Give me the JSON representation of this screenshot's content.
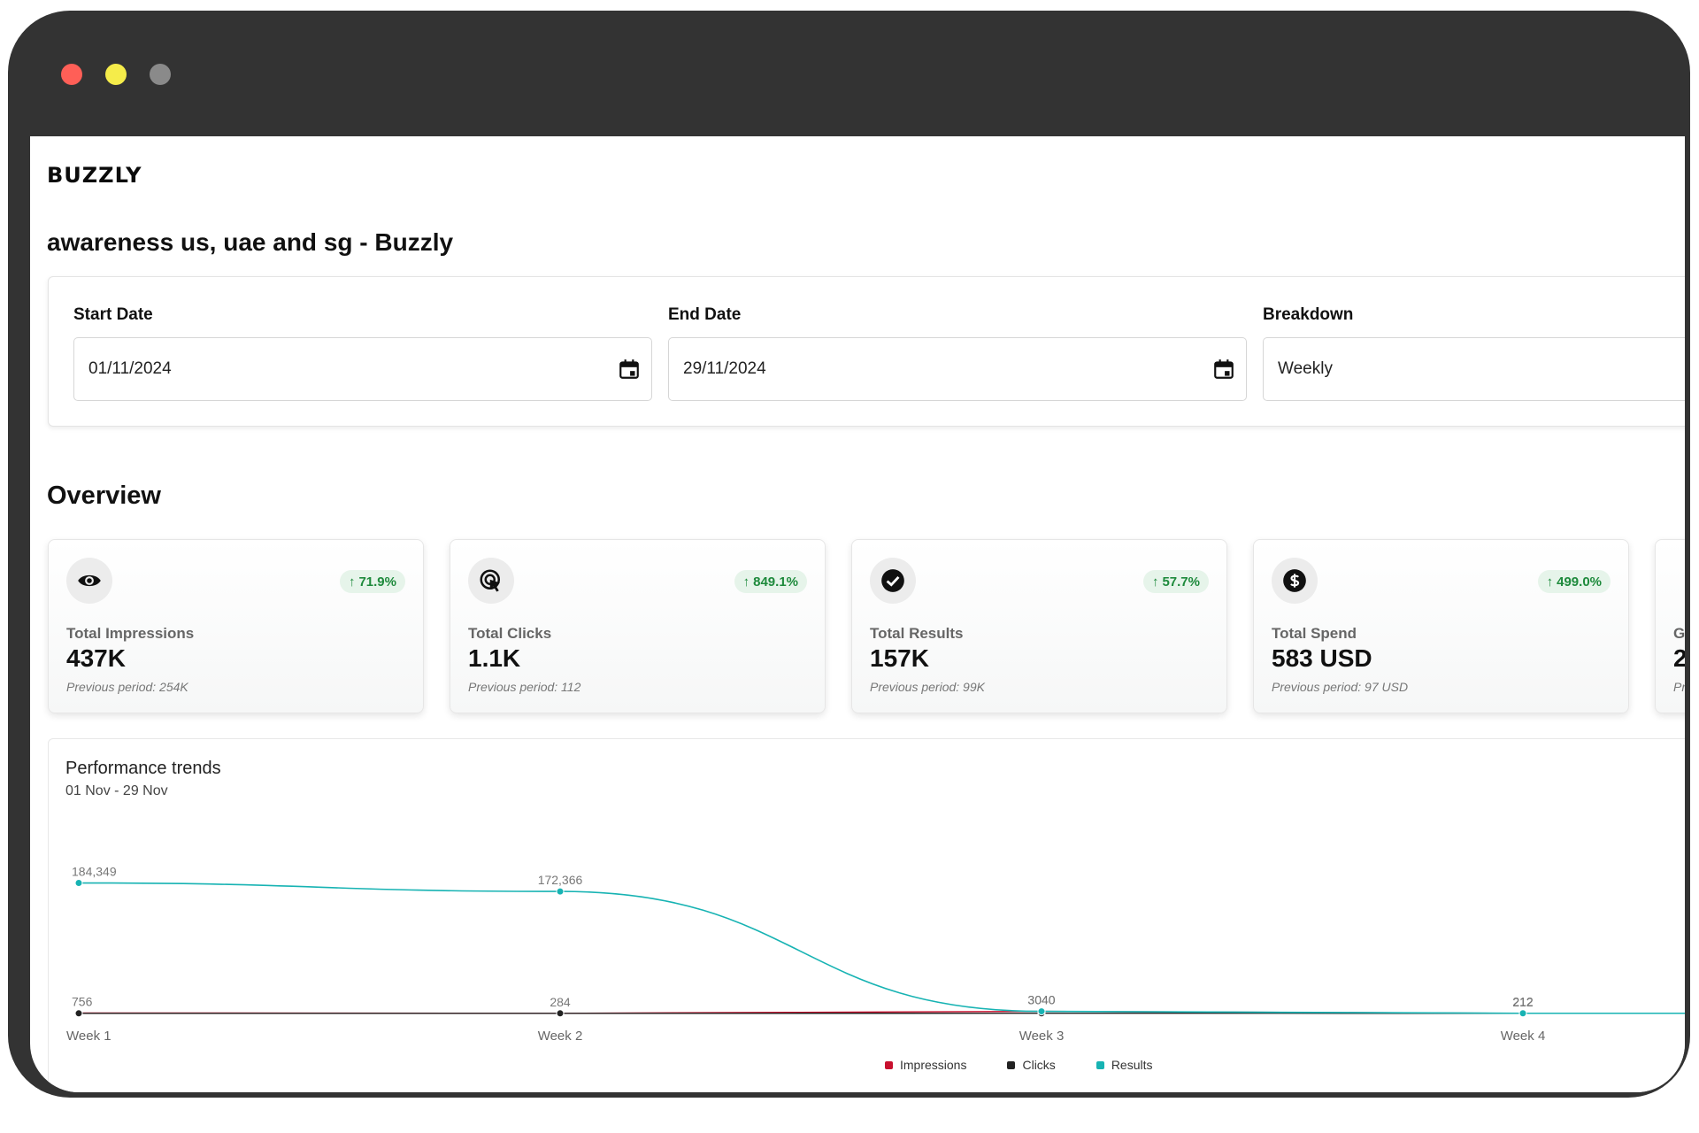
{
  "app": {
    "logo": "BUZZLY",
    "title": "awareness us, uae and sg - Buzzly"
  },
  "filters": {
    "start": {
      "label": "Start Date",
      "value": "01/11/2024",
      "icon": "calendar-icon"
    },
    "end": {
      "label": "End Date",
      "value": "29/11/2024",
      "icon": "calendar-icon"
    },
    "breakdown": {
      "label": "Breakdown",
      "value": "Weekly"
    }
  },
  "overview": {
    "title": "Overview",
    "cards": [
      {
        "icon": "eye-icon",
        "change": "71.9%",
        "label": "Total Impressions",
        "value": "437K",
        "previous": "Previous period: 254K"
      },
      {
        "icon": "cursor-click-icon",
        "change": "849.1%",
        "label": "Total Clicks",
        "value": "1.1K",
        "previous": "Previous period: 112"
      },
      {
        "icon": "check-circle-icon",
        "change": "57.7%",
        "label": "Total Results",
        "value": "157K",
        "previous": "Previous period: 99K"
      },
      {
        "icon": "dollar-circle-icon",
        "change": "499.0%",
        "label": "Total Spend",
        "value": "583 USD",
        "previous": "Previous period: 97 USD"
      },
      {
        "label": "G",
        "value": "2",
        "previous": "Pr"
      }
    ]
  },
  "chart": {
    "title": "Performance trends",
    "subtitle": "01 Nov - 29 Nov",
    "colors": {
      "impressions": "#c8102e",
      "clicks": "#222222",
      "results": "#17b3b3"
    }
  },
  "chart_data": {
    "type": "line",
    "categories": [
      "Week 1",
      "Week 2",
      "Week 3",
      "Week 4"
    ],
    "series": [
      {
        "name": "Impressions",
        "values": [
          756,
          284,
          3040,
          212
        ]
      },
      {
        "name": "Clicks",
        "values": [
          261,
          249,
          346,
          313
        ]
      },
      {
        "name": "Results",
        "values": [
          184349,
          172366,
          3040,
          313
        ]
      }
    ],
    "point_labels": {
      "Impressions": [
        "756",
        "284",
        "3040",
        "212"
      ],
      "Results": [
        "184,349",
        "172,366",
        "3040",
        "212"
      ]
    },
    "ylim": [
      0,
      200000
    ],
    "legend": "bottom-center",
    "grid": false
  }
}
